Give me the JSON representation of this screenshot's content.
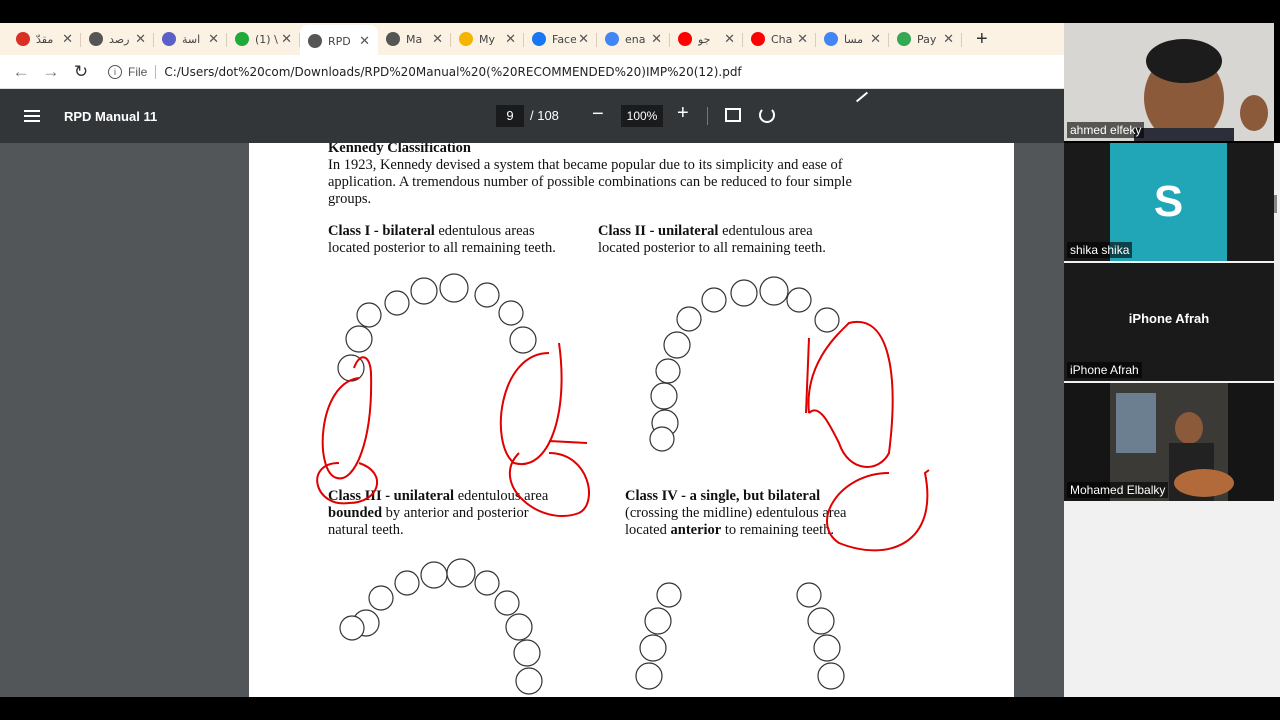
{
  "tabs": [
    {
      "label": "مقدّ",
      "favicon": "gmail-icon",
      "color": "#d93025"
    },
    {
      "label": "رصد",
      "favicon": "globe-icon",
      "color": "#555555"
    },
    {
      "label": "اسة",
      "favicon": "teams-icon",
      "color": "#5b5fc7"
    },
    {
      "label": "(1) \\",
      "favicon": "whatsapp-icon",
      "color": "#1faa3a"
    },
    {
      "label": "RPD",
      "favicon": "globe-icon",
      "color": "#555555",
      "active": true
    },
    {
      "label": "Ma",
      "favicon": "globe-icon",
      "color": "#555555"
    },
    {
      "label": "My",
      "favicon": "drive-icon",
      "color": "#f4b400"
    },
    {
      "label": "Face",
      "favicon": "facebook-icon",
      "color": "#1877f2"
    },
    {
      "label": "ena",
      "favicon": "google-icon",
      "color": "#4285f4"
    },
    {
      "label": "جو",
      "favicon": "youtube-icon",
      "color": "#ff0000"
    },
    {
      "label": "Cha",
      "favicon": "youtube-icon",
      "color": "#ff0000"
    },
    {
      "label": "مسا",
      "favicon": "google-icon",
      "color": "#4285f4"
    },
    {
      "label": "Pay",
      "favicon": "google-pay-icon",
      "color": "#34a853"
    }
  ],
  "toolbar": {
    "scheme": "File",
    "url": "C:/Users/dot%20com/Downloads/RPD%20Manual%20(%20RECOMMENDED%20)IMP%20(12).pdf"
  },
  "pdf": {
    "title": "RPD Manual 11",
    "page": "9",
    "total": "/ 108",
    "zoom": "100%"
  },
  "page": {
    "heading": "Kennedy Classification",
    "intro": "In 1923, Kennedy devised a system that became popular due to its simplicity and ease of application.  A tremendous number of possible combinations can be reduced to four simple groups.",
    "class1_bold": "Class I - bilateral",
    "class1_rest": " edentulous areas located posterior to all remaining teeth.",
    "class2_bold": "Class II - unilateral",
    "class2_rest": " edentulous area located posterior to all remaining teeth.",
    "class3_bold": "Class III - unilateral",
    "class3_rest1": " edentulous area",
    "class3_bold2": "bounded",
    "class3_rest2": " by anterior and posterior natural teeth.",
    "class4_bold": "Class IV - a single, but bilateral",
    "class4_rest1": " (crossing the midline) edentulous area located ",
    "class4_bold2": "anterior",
    "class4_rest2": " to remaining teeth."
  },
  "participants": [
    {
      "name": "ahmed elfeky",
      "type": "video"
    },
    {
      "name": "shika shika",
      "type": "avatar",
      "initial": "S",
      "color": "#21a6b8"
    },
    {
      "name": "iPhone Afrah",
      "type": "name-only",
      "center": "iPhone Afrah"
    },
    {
      "name": "Mohamed Elbalky",
      "type": "video"
    }
  ],
  "colors": {
    "annotation": "#e00000",
    "pdf_toolbar": "#323639",
    "viewer_bg": "#525659"
  }
}
